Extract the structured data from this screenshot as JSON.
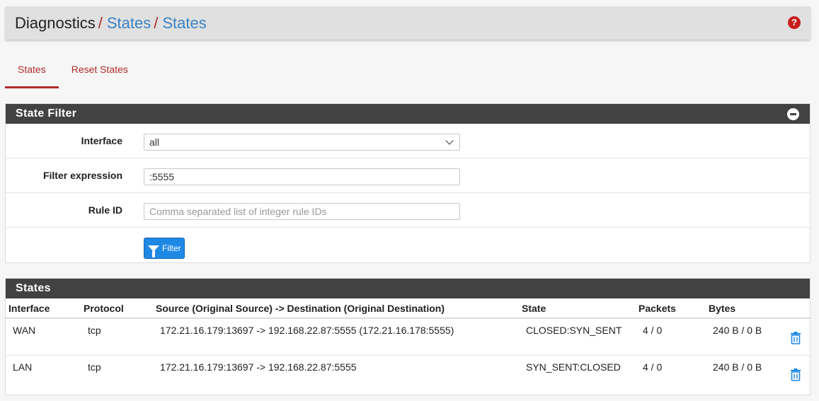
{
  "breadcrumb": {
    "root": "Diagnostics",
    "sep": "/",
    "level1": "States",
    "level2": "States"
  },
  "help_icon": "question-icon",
  "tabs": [
    {
      "label": "States",
      "active": true
    },
    {
      "label": "Reset States",
      "active": false
    }
  ],
  "filter_panel": {
    "title": "State Filter",
    "interface_label": "Interface",
    "interface_value": "all",
    "filter_expression_label": "Filter expression",
    "filter_expression_value": ":5555",
    "rule_id_label": "Rule ID",
    "rule_id_placeholder": "Comma separated list of integer rule IDs",
    "filter_button": "Filter"
  },
  "states_panel": {
    "title": "States",
    "columns": [
      "Interface",
      "Protocol",
      "Source (Original Source) -> Destination (Original Destination)",
      "State",
      "Packets",
      "Bytes"
    ],
    "rows": [
      {
        "interface": "WAN",
        "protocol": "tcp",
        "connection": "172.21.16.179:13697 -> 192.168.22.87:5555 (172.21.16.178:5555)",
        "state": "CLOSED:SYN_SENT",
        "packets": "4 / 0",
        "bytes": "240 B / 0 B"
      },
      {
        "interface": "LAN",
        "protocol": "tcp",
        "connection": "172.21.16.179:13697 -> 192.168.22.87:5555",
        "state": "SYN_SENT:CLOSED",
        "packets": "4 / 0",
        "bytes": "240 B / 0 B"
      }
    ]
  },
  "colors": {
    "accent": "#b02a2a",
    "link": "#3b82c4",
    "panel_header": "#424242",
    "button": "#1e88e5"
  }
}
